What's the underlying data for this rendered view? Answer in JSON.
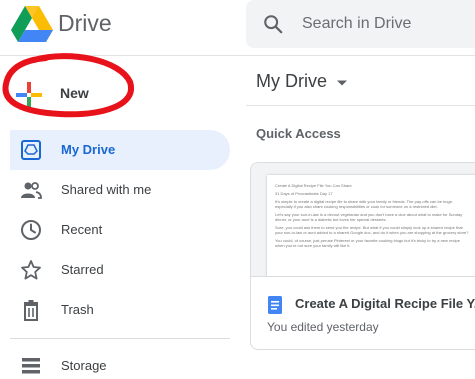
{
  "app": {
    "name": "Drive"
  },
  "search": {
    "placeholder": "Search in Drive"
  },
  "new_button": {
    "label": "New"
  },
  "sidebar": {
    "items": [
      {
        "label": "My Drive",
        "icon": "my-drive-icon",
        "active": true
      },
      {
        "label": "Shared with me",
        "icon": "people-icon"
      },
      {
        "label": "Recent",
        "icon": "clock-icon"
      },
      {
        "label": "Starred",
        "icon": "star-icon"
      },
      {
        "label": "Trash",
        "icon": "trash-icon"
      },
      {
        "label": "Storage",
        "icon": "storage-icon"
      }
    ]
  },
  "main": {
    "title": "My Drive",
    "section": "Quick Access",
    "file": {
      "name": "Create A Digital Recipe File Y...",
      "meta": "You edited yesterday",
      "type_icon": "docs-icon",
      "preview_lines": [
        "Create A Digital Recipe File You Can Share",
        "31 Days of Procrastinate Day 17",
        "It's simple to create a digital recipe file to share with your family or friends. The pay-offs can be huge, especially if you also share cooking responsibilities or cook for someone on a restricted diet.",
        "Let's say your son-in-law is a devout vegetarian and you don't have a clue about what to make for Sunday dinner, or your aunt is a diabetic but loves her special desserts.",
        "Sure, you could ask them to send you the recipe. But what if you could simply look up a shared recipe that your son-in-law or aunt added to a shared Google doc, and do it when you are shopping at the grocery store?",
        "You could, of course, just peruse Pinterest or your favorite cooking blogs but it's tricky to try a new recipe when you're not sure your family will like it."
      ]
    }
  },
  "colors": {
    "accent": "#1967d2",
    "active_bg": "#e8f0fe",
    "annotation": "#e8121b"
  }
}
